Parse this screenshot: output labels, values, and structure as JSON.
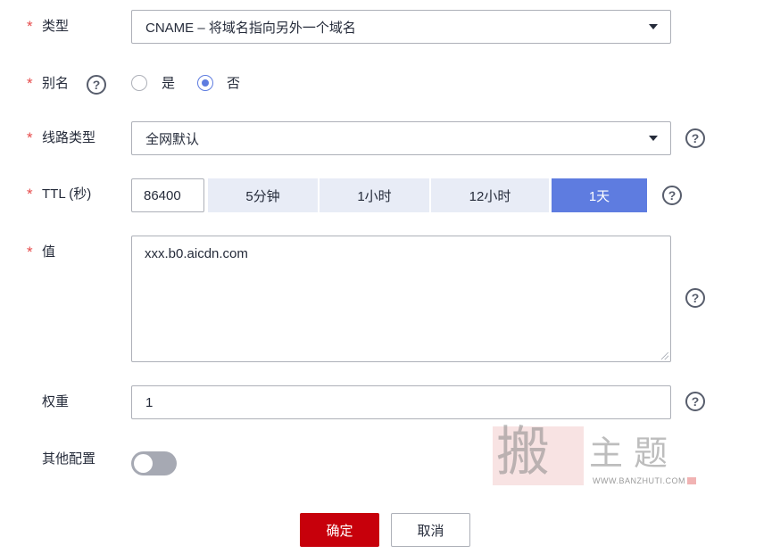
{
  "form": {
    "required_mark": "*",
    "type": {
      "label": "类型",
      "value": "CNAME – 将域名指向另外一个域名"
    },
    "alias": {
      "label": "别名",
      "options": [
        "是",
        "否"
      ],
      "selected": "否"
    },
    "line": {
      "label": "线路类型",
      "value": "全网默认"
    },
    "ttl": {
      "label": "TTL (秒)",
      "value": "86400",
      "presets": [
        "5分钟",
        "1小时",
        "12小时",
        "1天"
      ],
      "active": "1天"
    },
    "value": {
      "label": "值",
      "text": "xxx.b0.aicdn.com"
    },
    "weight": {
      "label": "权重",
      "value": "1"
    },
    "other": {
      "label": "其他配置",
      "enabled": false
    }
  },
  "help_glyph": "?",
  "buttons": {
    "confirm": "确定",
    "cancel": "取消"
  },
  "watermark": {
    "seal_char": "搬",
    "text": "主题",
    "url": "WWW.BANZHUTI.COM"
  },
  "colors": {
    "required": "#e64b4b",
    "accent": "#5e7ce0",
    "primary_button": "#c7000b",
    "ttl_preset_bg": "#e8ecf6",
    "toggle_off": "#a6a9b3"
  },
  "icons": [
    "question-circle-icon",
    "chevron-down-icon",
    "resize-grip-icon"
  ]
}
